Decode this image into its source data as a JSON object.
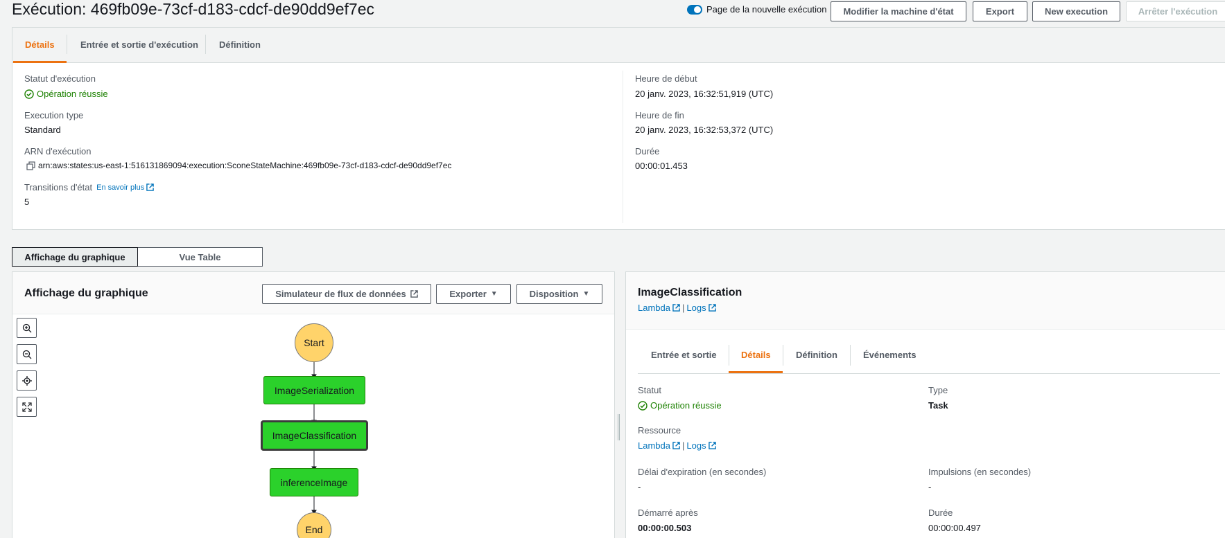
{
  "header": {
    "title": "Exécution: 469fb09e-73cf-d183-cdcf-de90dd9ef7ec",
    "toggle_label": "Page de la nouvelle exécution",
    "buttons": {
      "edit": "Modifier la machine d'état",
      "export": "Export",
      "new": "New execution",
      "stop": "Arrêter l'exécution"
    }
  },
  "details_tabs": [
    "Détails",
    "Entrée et sortie d'exécution",
    "Définition"
  ],
  "details": {
    "status_label": "Statut d'exécution",
    "status_value": "Opération réussie",
    "type_label": "Execution type",
    "type_value": "Standard",
    "arn_label": "ARN d'exécution",
    "arn_value": "arn:aws:states:us-east-1:516131869094:execution:SconeStateMachine:469fb09e-73cf-d183-cdcf-de90dd9ef7ec",
    "transitions_label": "Transitions d'état",
    "learn_more": "En savoir plus",
    "transitions_value": "5",
    "start_label": "Heure de début",
    "start_value": "20 janv. 2023, 16:32:51,919 (UTC)",
    "end_label": "Heure de fin",
    "end_value": "20 janv. 2023, 16:32:53,372 (UTC)",
    "duration_label": "Durée",
    "duration_value": "00:00:01.453"
  },
  "view_toggle": {
    "graph": "Affichage du graphique",
    "table": "Vue Table"
  },
  "graph_panel": {
    "title": "Affichage du graphique",
    "simulator": "Simulateur de flux de données",
    "export": "Exporter",
    "layout": "Disposition",
    "nodes": {
      "start": "Start",
      "n1": "ImageSerialization",
      "n2": "ImageClassification",
      "n3": "inferenceImage",
      "end": "End"
    }
  },
  "step_panel": {
    "title": "ImageClassification",
    "lambda": "Lambda",
    "sep": "|",
    "logs": "Logs",
    "tabs": [
      "Entrée et sortie",
      "Détails",
      "Définition",
      "Événements"
    ],
    "status_label": "Statut",
    "status_value": "Opération réussie",
    "type_label": "Type",
    "type_value": "Task",
    "resource_label": "Ressource",
    "timeout_label": "Délai d'expiration (en secondes)",
    "timeout_value": "-",
    "heartbeat_label": "Impulsions (en secondes)",
    "heartbeat_value": "-",
    "started_label": "Démarré après",
    "started_value": "00:00:00.503",
    "duration_label": "Durée",
    "duration_value": "00:00:00.497"
  },
  "colors": {
    "accent": "#ec7211",
    "link": "#0073bb",
    "success": "#1d8102",
    "state_green": "#2bd12b",
    "terminal_yellow": "#ffd36a"
  }
}
